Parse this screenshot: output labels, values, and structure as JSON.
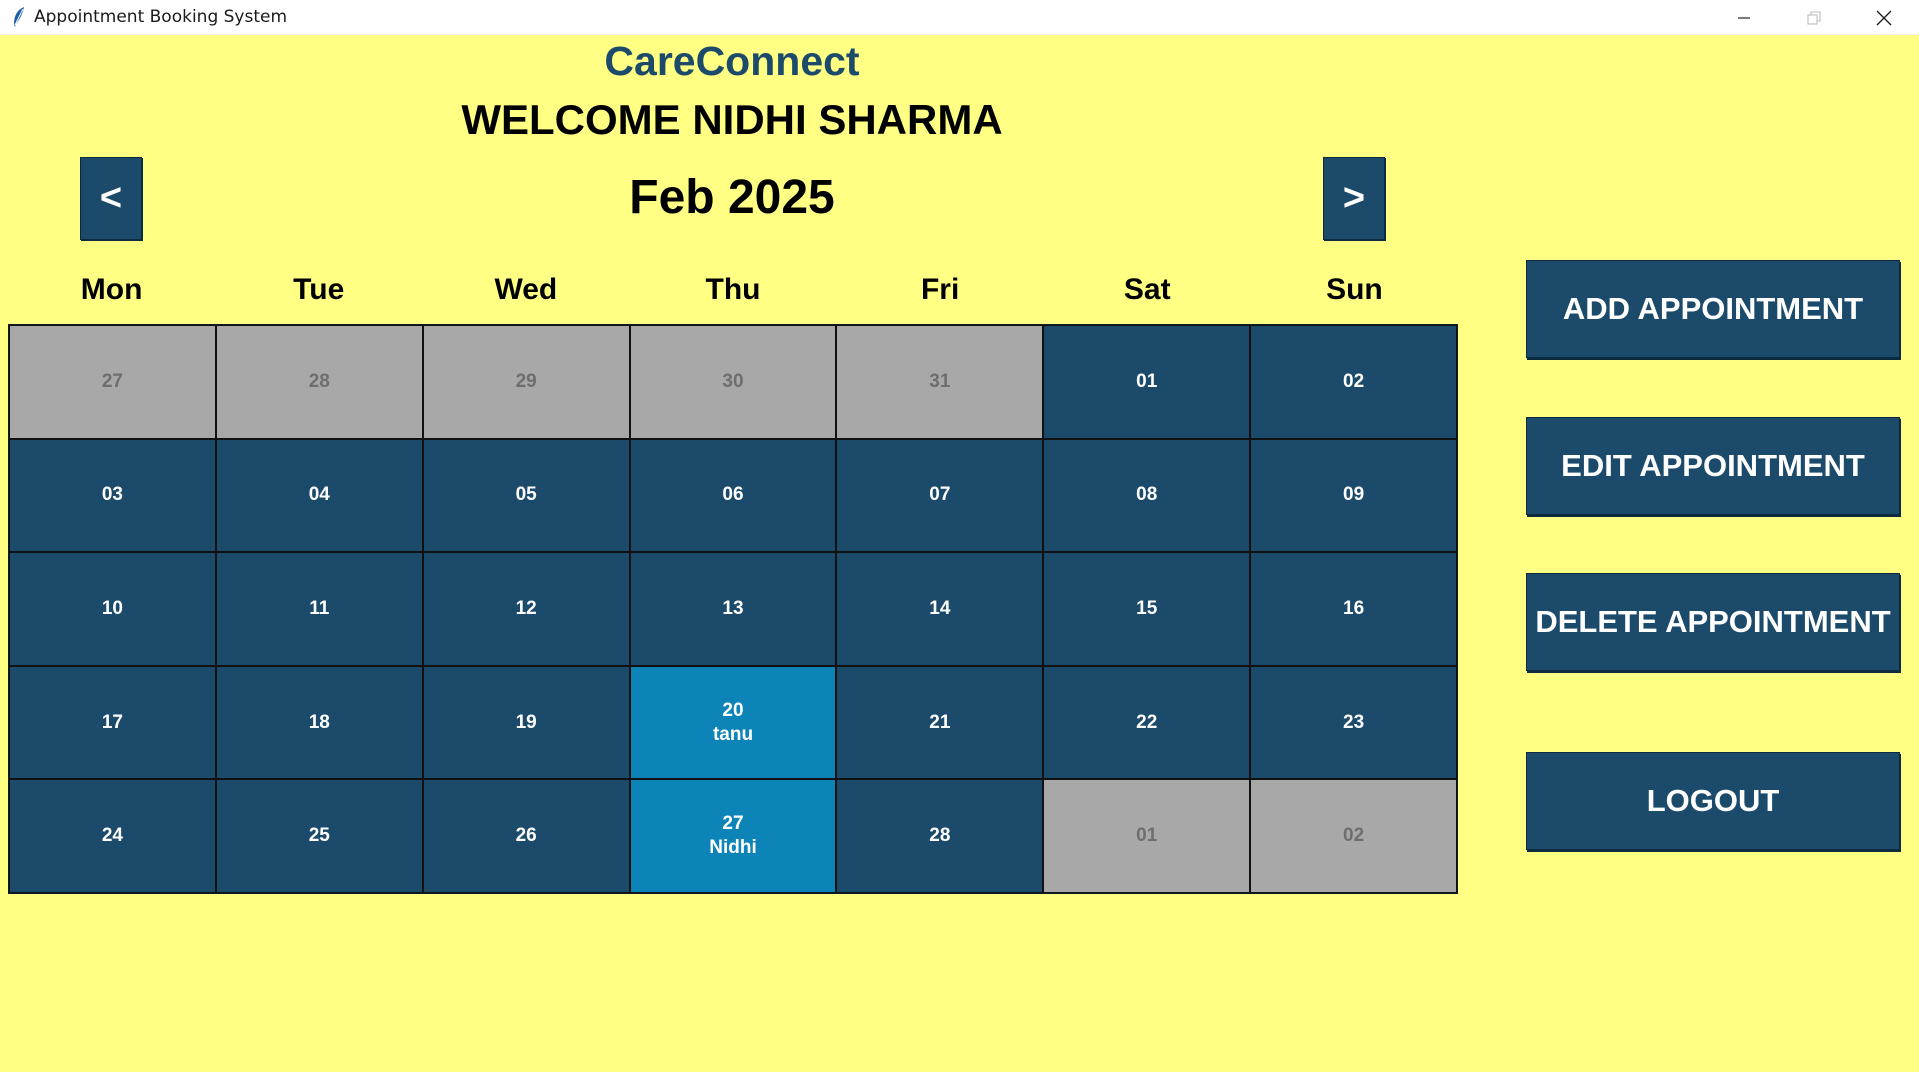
{
  "window": {
    "title": "Appointment Booking System"
  },
  "header": {
    "brand": "CareConnect",
    "welcome": "WELCOME NIDHI SHARMA"
  },
  "calendar": {
    "month_label": "Feb 2025",
    "prev_label": "<",
    "next_label": ">",
    "weekdays": [
      "Mon",
      "Tue",
      "Wed",
      "Thu",
      "Fri",
      "Sat",
      "Sun"
    ],
    "weeks": [
      [
        {
          "day": "27",
          "state": "outside"
        },
        {
          "day": "28",
          "state": "outside"
        },
        {
          "day": "29",
          "state": "outside"
        },
        {
          "day": "30",
          "state": "outside"
        },
        {
          "day": "31",
          "state": "outside"
        },
        {
          "day": "01",
          "state": "active"
        },
        {
          "day": "02",
          "state": "active"
        }
      ],
      [
        {
          "day": "03",
          "state": "active"
        },
        {
          "day": "04",
          "state": "active"
        },
        {
          "day": "05",
          "state": "active"
        },
        {
          "day": "06",
          "state": "active"
        },
        {
          "day": "07",
          "state": "active"
        },
        {
          "day": "08",
          "state": "active"
        },
        {
          "day": "09",
          "state": "active"
        }
      ],
      [
        {
          "day": "10",
          "state": "active"
        },
        {
          "day": "11",
          "state": "active"
        },
        {
          "day": "12",
          "state": "active"
        },
        {
          "day": "13",
          "state": "active"
        },
        {
          "day": "14",
          "state": "active"
        },
        {
          "day": "15",
          "state": "active"
        },
        {
          "day": "16",
          "state": "active"
        }
      ],
      [
        {
          "day": "17",
          "state": "active"
        },
        {
          "day": "18",
          "state": "active"
        },
        {
          "day": "19",
          "state": "active"
        },
        {
          "day": "20",
          "state": "booked",
          "note": "tanu"
        },
        {
          "day": "21",
          "state": "active"
        },
        {
          "day": "22",
          "state": "active"
        },
        {
          "day": "23",
          "state": "active"
        }
      ],
      [
        {
          "day": "24",
          "state": "active"
        },
        {
          "day": "25",
          "state": "active"
        },
        {
          "day": "26",
          "state": "active"
        },
        {
          "day": "27",
          "state": "booked",
          "note": "Nidhi"
        },
        {
          "day": "28",
          "state": "active"
        },
        {
          "day": "01",
          "state": "outside"
        },
        {
          "day": "02",
          "state": "outside"
        }
      ]
    ]
  },
  "actions": {
    "add": "ADD APPOINTMENT",
    "edit": "EDIT APPOINTMENT",
    "delete": "DELETE APPOINTMENT",
    "logout": "LOGOUT"
  },
  "colors": {
    "background": "#ffff84",
    "primary": "#1b4a6b",
    "booked": "#0d84b8",
    "outside": "#a8a8a8"
  },
  "icons": {
    "app": "feather-icon",
    "minimize": "minimize-icon",
    "maximize": "maximize-icon",
    "close": "close-icon"
  }
}
